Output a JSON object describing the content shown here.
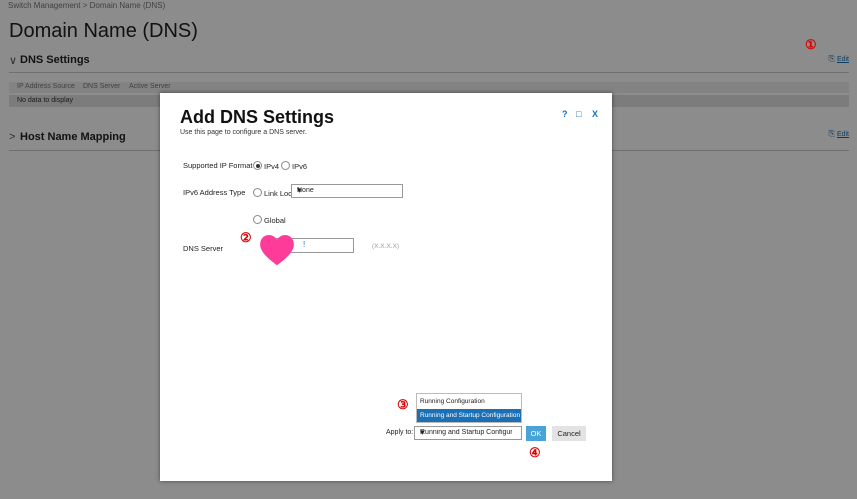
{
  "breadcrumb": "Switch Management > Domain Name (DNS)",
  "page_title": "Domain Name (DNS)",
  "dns_settings": {
    "title": "DNS Settings",
    "edit_label": "Edit",
    "columns": [
      "IP Address Source",
      "DNS Server",
      "Active Server"
    ],
    "empty_text": "No data to display"
  },
  "host_mapping": {
    "title": "Host Name Mapping",
    "edit_label": "Edit"
  },
  "dialog": {
    "title": "Add DNS Settings",
    "subtitle": "Use this page to configure a DNS server.",
    "controls": {
      "help": "?",
      "maximize": "□",
      "close": "X"
    },
    "ip_format": {
      "label": "Supported IP Format",
      "options": [
        "IPv4",
        "IPv6"
      ],
      "selected": "IPv4"
    },
    "ipv6_type": {
      "label": "IPv6 Address Type",
      "link_local": "Link Local",
      "global": "Global",
      "interface_value": "None"
    },
    "dns_server": {
      "label": "DNS Server",
      "value": "!",
      "hint": "(X.X.X.X)"
    },
    "apply_to": {
      "label": "Apply to:",
      "value": "Running and Startup Configuratic",
      "options": [
        "Running Configuration",
        "Running and Startup Configuration"
      ]
    },
    "ok_label": "OK",
    "cancel_label": "Cancel"
  },
  "annotations": [
    "①",
    "②",
    "③",
    "④"
  ],
  "colors": {
    "accent": "#1a6fb5",
    "ok": "#4aa3d8",
    "annotation": "#d00000",
    "heart": "#ff3b9a"
  }
}
